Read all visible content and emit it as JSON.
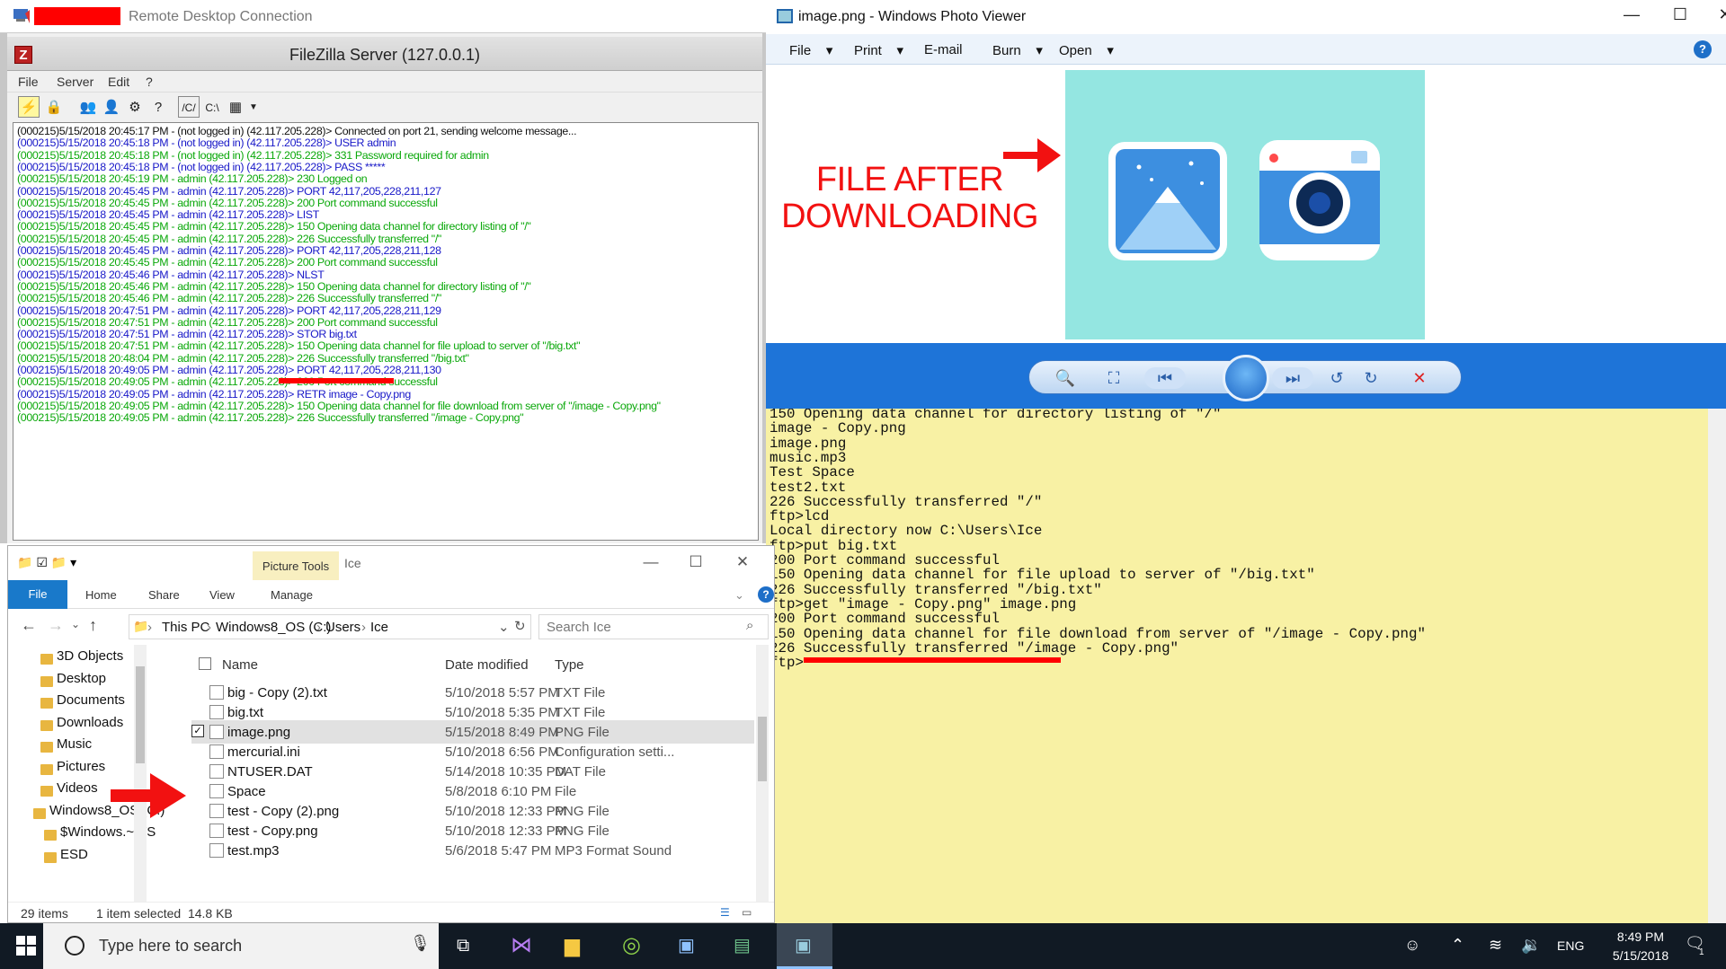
{
  "rdp": {
    "title": "Remote Desktop Connection"
  },
  "filezilla": {
    "title": "FileZilla Server (127.0.0.1)",
    "menu": [
      "File",
      "Server",
      "Edit",
      "?"
    ],
    "toolbar": [
      "/C/",
      "C:\\"
    ],
    "log": [
      {
        "c": "black",
        "t": "(000215)5/15/2018 20:45:17 PM - (not logged in) (42.117.205.228)> Connected on port 21, sending welcome message..."
      },
      {
        "c": "blue",
        "t": "(000215)5/15/2018 20:45:18 PM - (not logged in) (42.117.205.228)> USER admin"
      },
      {
        "c": "green",
        "t": "(000215)5/15/2018 20:45:18 PM - (not logged in) (42.117.205.228)> 331 Password required for admin"
      },
      {
        "c": "blue",
        "t": "(000215)5/15/2018 20:45:18 PM - (not logged in) (42.117.205.228)> PASS *****"
      },
      {
        "c": "green",
        "t": "(000215)5/15/2018 20:45:19 PM - admin (42.117.205.228)> 230 Logged on"
      },
      {
        "c": "blue",
        "t": "(000215)5/15/2018 20:45:45 PM - admin (42.117.205.228)> PORT 42,117,205,228,211,127"
      },
      {
        "c": "green",
        "t": "(000215)5/15/2018 20:45:45 PM - admin (42.117.205.228)> 200 Port command successful"
      },
      {
        "c": "blue",
        "t": "(000215)5/15/2018 20:45:45 PM - admin (42.117.205.228)> LIST"
      },
      {
        "c": "green",
        "t": "(000215)5/15/2018 20:45:45 PM - admin (42.117.205.228)> 150 Opening data channel for directory listing of \"/\""
      },
      {
        "c": "green",
        "t": "(000215)5/15/2018 20:45:45 PM - admin (42.117.205.228)> 226 Successfully transferred \"/\""
      },
      {
        "c": "blue",
        "t": "(000215)5/15/2018 20:45:45 PM - admin (42.117.205.228)> PORT 42,117,205,228,211,128"
      },
      {
        "c": "green",
        "t": "(000215)5/15/2018 20:45:45 PM - admin (42.117.205.228)> 200 Port command successful"
      },
      {
        "c": "blue",
        "t": "(000215)5/15/2018 20:45:46 PM - admin (42.117.205.228)> NLST"
      },
      {
        "c": "green",
        "t": "(000215)5/15/2018 20:45:46 PM - admin (42.117.205.228)> 150 Opening data channel for directory listing of \"/\""
      },
      {
        "c": "green",
        "t": "(000215)5/15/2018 20:45:46 PM - admin (42.117.205.228)> 226 Successfully transferred \"/\""
      },
      {
        "c": "blue",
        "t": "(000215)5/15/2018 20:47:51 PM - admin (42.117.205.228)> PORT 42,117,205,228,211,129"
      },
      {
        "c": "green",
        "t": "(000215)5/15/2018 20:47:51 PM - admin (42.117.205.228)> 200 Port command successful"
      },
      {
        "c": "blue",
        "t": "(000215)5/15/2018 20:47:51 PM - admin (42.117.205.228)> STOR big.txt"
      },
      {
        "c": "green",
        "t": "(000215)5/15/2018 20:47:51 PM - admin (42.117.205.228)> 150 Opening data channel for file upload to server of \"/big.txt\""
      },
      {
        "c": "green",
        "t": "(000215)5/15/2018 20:48:04 PM - admin (42.117.205.228)> 226 Successfully transferred \"/big.txt\""
      },
      {
        "c": "blue",
        "t": "(000215)5/15/2018 20:49:05 PM - admin (42.117.205.228)> PORT 42,117,205,228,211,130"
      },
      {
        "c": "green",
        "t": "(000215)5/15/2018 20:49:05 PM - admin (42.117.205.228)> 200 Port command successful"
      },
      {
        "c": "blue",
        "t": "(000215)5/15/2018 20:49:05 PM - admin (42.117.205.228)> RETR image - Copy.png"
      },
      {
        "c": "green",
        "t": "(000215)5/15/2018 20:49:05 PM - admin (42.117.205.228)> 150 Opening data channel for file download from server of \"/image - Copy.png\""
      },
      {
        "c": "green",
        "t": "(000215)5/15/2018 20:49:05 PM - admin (42.117.205.228)> 226 Successfully transferred \"/image - Copy.png\""
      }
    ]
  },
  "photo_viewer": {
    "title": "image.png - Windows Photo Viewer",
    "menu": [
      "File",
      "Print",
      "E-mail",
      "Burn",
      "Open"
    ],
    "annotation_line1": "FILE AFTER",
    "annotation_line2": "DOWNLOADING",
    "colors": {
      "image_bg": "#94e6e1",
      "toolbar": "#1e74d8",
      "annotation": "#f21111"
    }
  },
  "console": [
    "150 Opening data channel for directory listing of \"/\"",
    "image - Copy.png",
    "image.png",
    "music.mp3",
    "Test Space",
    "test2.txt",
    "226 Successfully transferred \"/\"",
    "ftp>lcd",
    "Local directory now C:\\Users\\Ice",
    "ftp>put big.txt",
    "200 Port command successful",
    "150 Opening data channel for file upload to server of \"/big.txt\"",
    "226 Successfully transferred \"/big.txt\"",
    "ftp>get \"image - Copy.png\" image.png",
    "200 Port command successful",
    "150 Opening data channel for file download from server of \"/image - Copy.png\"",
    "226 Successfully transferred \"/image - Copy.png\"",
    "ftp>"
  ],
  "explorer": {
    "picture_tools": "Picture Tools",
    "title": "Ice",
    "ribbon": [
      "File",
      "Home",
      "Share",
      "View",
      "Manage"
    ],
    "breadcrumb": [
      "This PC",
      "Windows8_OS (C:)",
      "Users",
      "Ice"
    ],
    "search_placeholder": "Search Ice",
    "nav": [
      "3D Objects",
      "Desktop",
      "Documents",
      "Downloads",
      "Music",
      "Pictures",
      "Videos",
      "Windows8_OS (C:)",
      "$Windows.~WS",
      "ESD"
    ],
    "columns": [
      "Name",
      "Date modified",
      "Type"
    ],
    "files": [
      {
        "name": "big - Copy (2).txt",
        "date": "5/10/2018 5:57 PM",
        "type": "TXT File"
      },
      {
        "name": "big.txt",
        "date": "5/10/2018 5:35 PM",
        "type": "TXT File"
      },
      {
        "name": "image.png",
        "date": "5/15/2018 8:49 PM",
        "type": "PNG File",
        "selected": true
      },
      {
        "name": "mercurial.ini",
        "date": "5/10/2018 6:56 PM",
        "type": "Configuration setti..."
      },
      {
        "name": "NTUSER.DAT",
        "date": "5/14/2018 10:35 PM",
        "type": "DAT File"
      },
      {
        "name": "Space",
        "date": "5/8/2018 6:10 PM",
        "type": "File"
      },
      {
        "name": "test - Copy (2).png",
        "date": "5/10/2018 12:33 PM",
        "type": "PNG File"
      },
      {
        "name": "test - Copy.png",
        "date": "5/10/2018 12:33 PM",
        "type": "PNG File"
      },
      {
        "name": "test.mp3",
        "date": "5/6/2018 5:47 PM",
        "type": "MP3 Format Sound"
      }
    ],
    "status_items": "29 items",
    "status_selected": "1 item selected  14.8 KB"
  },
  "taskbar": {
    "search_placeholder": "Type here to search",
    "lang": "ENG",
    "time": "8:49 PM",
    "date": "5/15/2018",
    "notifications": "1"
  }
}
